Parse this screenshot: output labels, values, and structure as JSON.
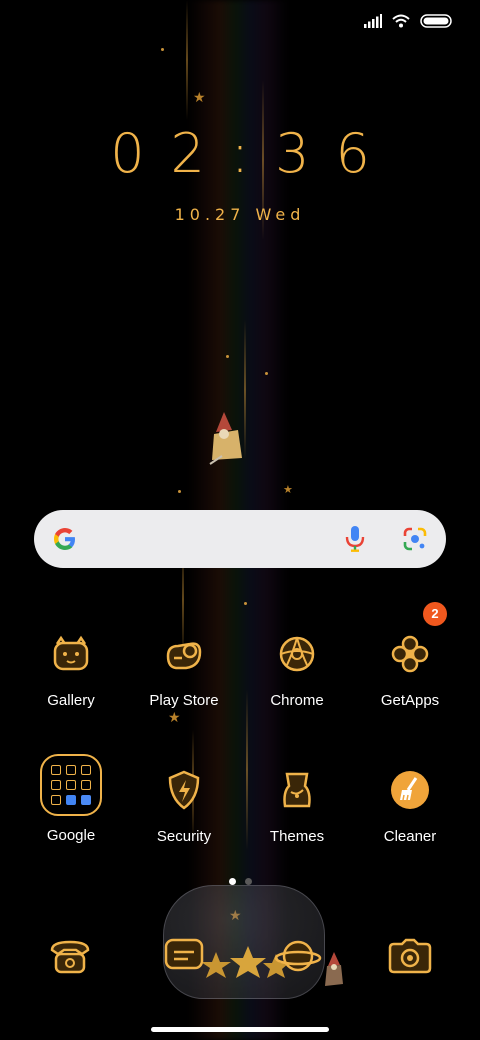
{
  "status_bar": {
    "signal": "signal-icon",
    "wifi": "wifi-icon",
    "battery": "battery-icon"
  },
  "clock": {
    "time": "02:36",
    "date": "10.27 Wed"
  },
  "search": {
    "logo": "google-g-icon",
    "mic": "mic-icon",
    "lens": "lens-icon"
  },
  "apps": [
    {
      "label": "Gallery",
      "icon": "gallery-icon"
    },
    {
      "label": "Play Store",
      "icon": "play-store-icon"
    },
    {
      "label": "Chrome",
      "icon": "chrome-icon"
    },
    {
      "label": "GetApps",
      "icon": "getapps-icon",
      "badge": "2"
    },
    {
      "label": "Google",
      "icon": "folder-icon"
    },
    {
      "label": "Security",
      "icon": "security-icon"
    },
    {
      "label": "Themes",
      "icon": "themes-icon"
    },
    {
      "label": "Cleaner",
      "icon": "cleaner-icon"
    }
  ],
  "page_indicator": {
    "pages": 2,
    "active": 1
  },
  "dock": [
    "phone-icon",
    "messages-icon",
    "browser-icon",
    "camera-icon"
  ],
  "colors": {
    "accent": "#f0b34a",
    "badge": "#f0581e",
    "background": "#000000"
  }
}
